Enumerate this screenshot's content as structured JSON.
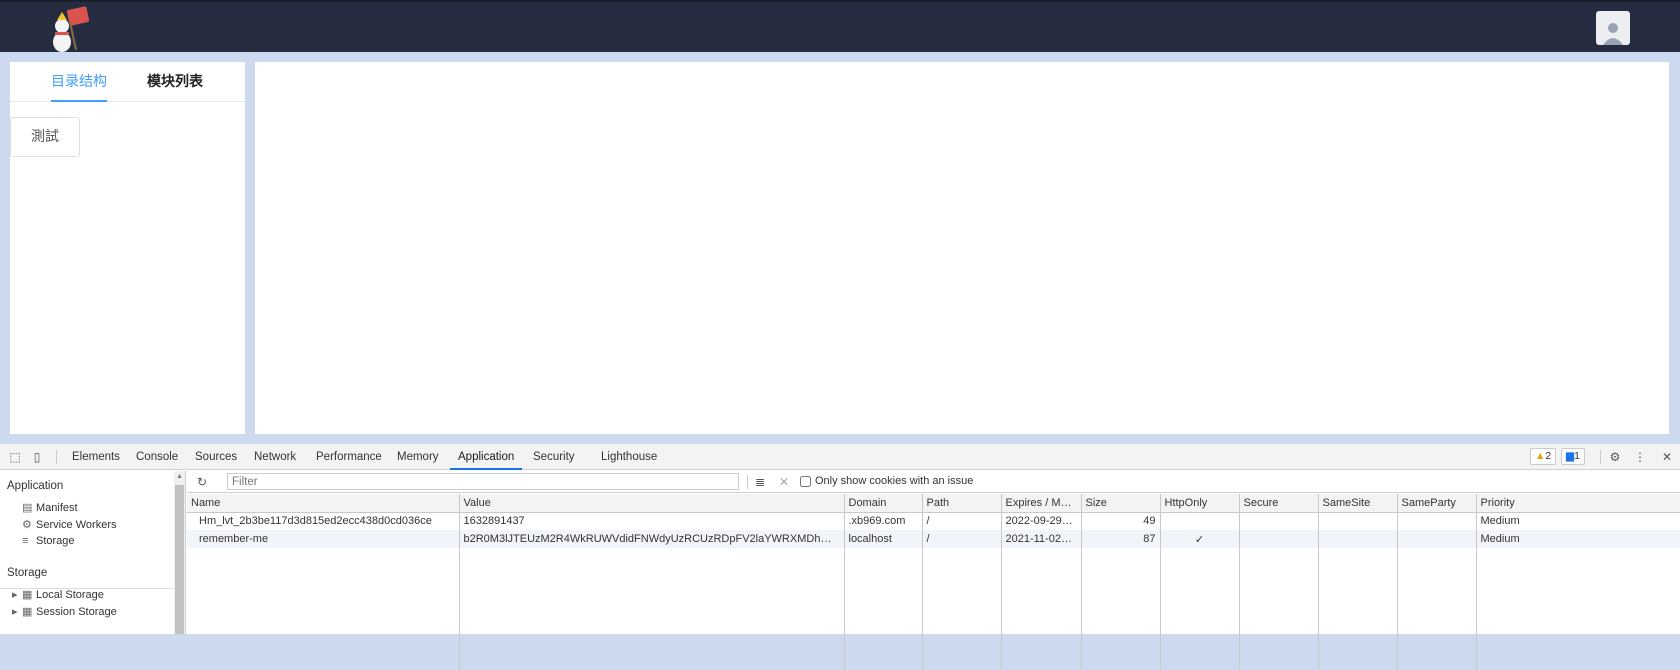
{
  "page": {
    "tabs": [
      {
        "label": "目录结构",
        "active": true
      },
      {
        "label": "模块列表",
        "active": false
      }
    ],
    "tree_node": "測試"
  },
  "devtools": {
    "panels": [
      "Elements",
      "Console",
      "Sources",
      "Network",
      "Performance",
      "Memory",
      "Application",
      "Security",
      "Lighthouse"
    ],
    "active_panel": "Application",
    "warnings_count": "2",
    "messages_count": "1",
    "sidebar": {
      "application_header": "Application",
      "application_items": [
        "Manifest",
        "Service Workers",
        "Storage"
      ],
      "storage_header": "Storage",
      "storage_items": [
        "Local Storage",
        "Session Storage"
      ]
    },
    "filter": {
      "placeholder": "Filter",
      "only_issue_label": "Only show cookies with an issue"
    },
    "columns": [
      "Name",
      "Value",
      "Domain",
      "Path",
      "Expires / Max-...",
      "Size",
      "HttpOnly",
      "Secure",
      "SameSite",
      "SameParty",
      "Priority"
    ],
    "rows": [
      [
        "Hm_lvt_2b3be117d3d815ed2ecc438d0cd036ce",
        "1632891437",
        ".xb969.com",
        "/",
        "2022-09-29T0...",
        "49",
        "",
        "",
        "",
        "",
        "Medium"
      ],
      [
        "remember-me",
        "b2R0M3lJTEUzM2R4WkRUWVdidFNWdyUzRCUzRDpFV2laYWRXMDhMMG9HMFd...",
        "localhost",
        "/",
        "2021-11-02T0...",
        "87",
        "✓",
        "",
        "",
        "",
        "Medium"
      ]
    ]
  },
  "colors": {
    "topbar": "#262c40",
    "accent": "#409eff",
    "devtools_active": "#1a73e8"
  }
}
